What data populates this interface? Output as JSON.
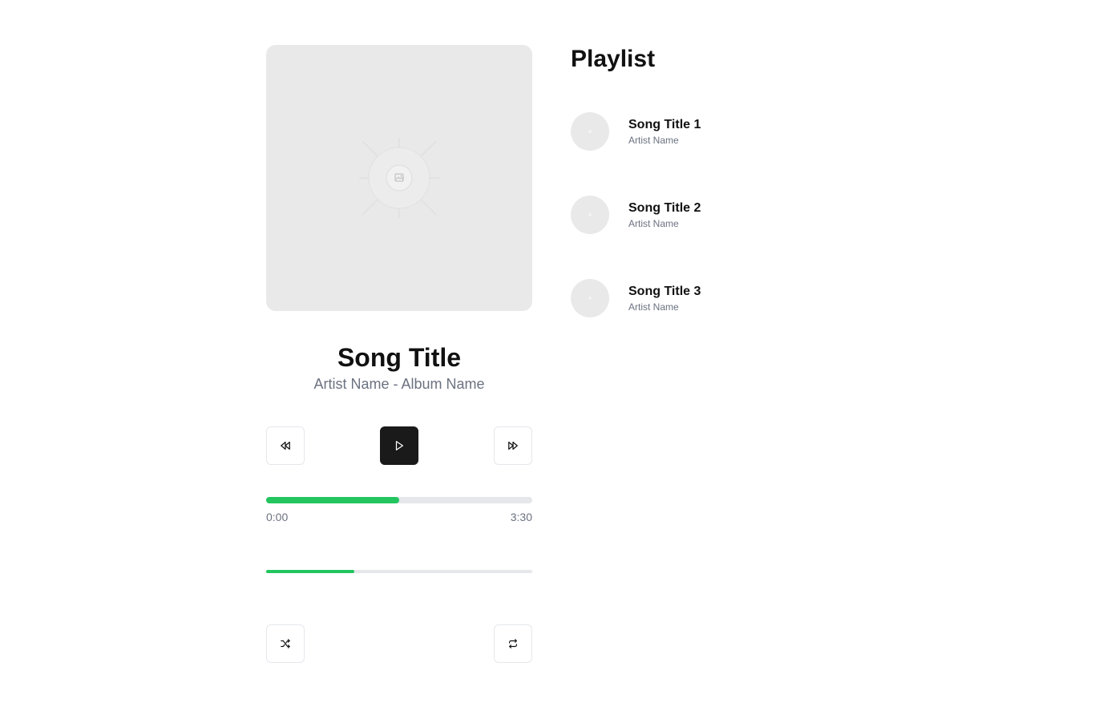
{
  "now_playing": {
    "title": "Song Title",
    "subtitle": "Artist Name - Album Name",
    "artwork_icon": "image-placeholder-icon"
  },
  "controls": {
    "previous_icon": "rewind-icon",
    "play_icon": "play-icon",
    "next_icon": "fast-forward-icon",
    "shuffle_icon": "shuffle-icon",
    "repeat_icon": "repeat-icon"
  },
  "progress": {
    "fraction": 0.5,
    "current_time": "0:00",
    "total_time": "3:30"
  },
  "volume": {
    "fraction": 0.33
  },
  "playlist": {
    "title": "Playlist",
    "items": [
      {
        "title": "Song Title 1",
        "artist": "Artist Name"
      },
      {
        "title": "Song Title 2",
        "artist": "Artist Name"
      },
      {
        "title": "Song Title 3",
        "artist": "Artist Name"
      }
    ]
  },
  "colors": {
    "accent": "#22c55e",
    "primary_button": "#1a1a1a",
    "muted_text": "#6b7280",
    "track": "#e5e7eb",
    "placeholder": "#e9e9e9"
  }
}
